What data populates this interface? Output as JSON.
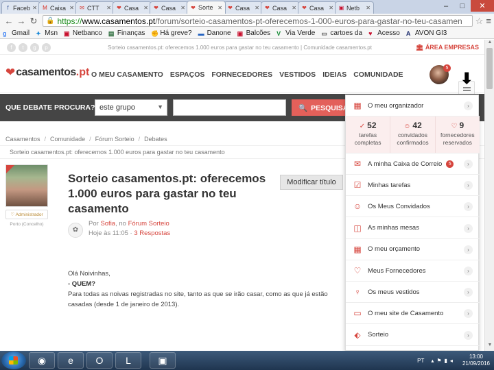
{
  "browser": {
    "tabs": [
      {
        "label": "Faceb",
        "icon": "facebook-icon",
        "color": "#3b5998",
        "active": false
      },
      {
        "label": "Caixa",
        "icon": "gmail-icon",
        "color": "#d93025",
        "active": false
      },
      {
        "label": "CTT",
        "icon": "ctt-icon",
        "color": "#d6453d",
        "active": false
      },
      {
        "label": "Casa",
        "icon": "heart-icon",
        "color": "#d6453d",
        "active": false
      },
      {
        "label": "Casa",
        "icon": "heart-icon",
        "color": "#d6453d",
        "active": false
      },
      {
        "label": "Sorte",
        "icon": "heart-icon",
        "color": "#d6453d",
        "active": true
      },
      {
        "label": "Casa",
        "icon": "heart-icon",
        "color": "#d6453d",
        "active": false
      },
      {
        "label": "Casa",
        "icon": "heart-icon",
        "color": "#d6453d",
        "active": false
      },
      {
        "label": "Casa",
        "icon": "heart-icon",
        "color": "#d6453d",
        "active": false
      },
      {
        "label": "Netb",
        "icon": "netbanco-icon",
        "color": "#c8102e",
        "active": false
      }
    ],
    "url": {
      "scheme": "https://",
      "host": "www.casamentos.pt",
      "path": "/forum/sorteio-casamentos-pt-oferecemos-1-000-euros-para-gastar-no-teu-casamen"
    },
    "bookmarks": [
      {
        "label": "Gmail",
        "icon": "google-icon",
        "color": "#4285f4"
      },
      {
        "label": "Msn",
        "icon": "msn-icon",
        "color": "#1c8ad9"
      },
      {
        "label": "Netbanco",
        "icon": "netbanco-icon",
        "color": "#c8102e"
      },
      {
        "label": "Finanças",
        "icon": "financas-icon",
        "color": "#2b6b3a"
      },
      {
        "label": "Há greve?",
        "icon": "strike-icon",
        "color": "#333333"
      },
      {
        "label": "Danone",
        "icon": "danone-icon",
        "color": "#1f5fbf"
      },
      {
        "label": "Balcões",
        "icon": "netbanco-icon",
        "color": "#c8102e"
      },
      {
        "label": "Via Verde",
        "icon": "viaverde-icon",
        "color": "#1b8e3a"
      },
      {
        "label": "cartoes da",
        "icon": "cards-icon",
        "color": "#555555"
      },
      {
        "label": "Acesso",
        "icon": "access-icon",
        "color": "#c8102e"
      },
      {
        "label": "AVON GI3",
        "icon": "avon-icon",
        "color": "#1a2a6c"
      }
    ]
  },
  "site": {
    "top_message": "Sorteio casamentos.pt: oferecemos 1.000 euros para gastar no teu casamento | Comunidade casamentos.pt",
    "area_empresas": "ÁREA EMPRESAS",
    "logo_name": "casamentos",
    "logo_tld": ".pt",
    "nav": [
      "O MEU CASAMENTO",
      "ESPAÇOS",
      "FORNECEDORES",
      "VESTIDOS",
      "IDEIAS",
      "COMUNIDADE"
    ],
    "avatar_badge": "5"
  },
  "search": {
    "label": "QUE DEBATE PROCURA?",
    "select_value": "este grupo",
    "input_value": "",
    "button_label": "PESQUISA"
  },
  "breadcrumbs": [
    "Casamentos",
    "Comunidade",
    "Fórum Sorteio",
    "Debates"
  ],
  "breadcrumb_title": "Sorteio casamentos.pt: oferecemos 1.000 euros para gastar no teu casamento",
  "post": {
    "author_role": "♡ Administrador",
    "author_location": "Porto (Concelho)",
    "title": "Sorteio casamentos.pt: oferecemos 1.000 euros para gastar no teu casamento",
    "modify_label": "Modificar título",
    "meta_por": "Por",
    "meta_author": "Sofia",
    "meta_no": ", no",
    "meta_forum": "Fórum Sorteio",
    "meta_time": "Hoje às 11:05 ·",
    "meta_replies": "3 Respostas",
    "body_greeting": "Olá Noivinhas,",
    "body_heading": "- QUEM?",
    "body_text": "Para todas as noivas registradas no site, tanto as que se irão casar, como as que já estão casadas (desde 1 de janeiro de 2013)."
  },
  "dropdown": {
    "header_label": "O meu organizador",
    "stats": [
      {
        "number": "52",
        "label": "tarefas completas",
        "icon": "check-circle-icon"
      },
      {
        "number": "42",
        "label": "convidados confirmados",
        "icon": "people-icon"
      },
      {
        "number": "9",
        "label": "fornecedores reservados",
        "icon": "heart-outline-icon"
      }
    ],
    "items": [
      {
        "label": "A minha Caixa de Correio",
        "icon": "mail-icon",
        "badge": "5"
      },
      {
        "label": "Minhas tarefas",
        "icon": "checklist-icon",
        "badge": ""
      },
      {
        "label": "Os Meus Convidados",
        "icon": "guests-icon",
        "badge": ""
      },
      {
        "label": "As minhas mesas",
        "icon": "tables-icon",
        "badge": ""
      },
      {
        "label": "O meu orçamento",
        "icon": "calculator-icon",
        "badge": ""
      },
      {
        "label": "Meus Fornecedores",
        "icon": "heart-outline-icon",
        "badge": ""
      },
      {
        "label": "Os meus vestidos",
        "icon": "dress-icon",
        "badge": ""
      },
      {
        "label": "O meu site de Casamento",
        "icon": "website-icon",
        "badge": ""
      },
      {
        "label": "Sorteio",
        "icon": "tag-icon",
        "badge": ""
      }
    ]
  },
  "taskbar": {
    "language": "PT",
    "time": "13:00",
    "date": "21/09/2016"
  }
}
